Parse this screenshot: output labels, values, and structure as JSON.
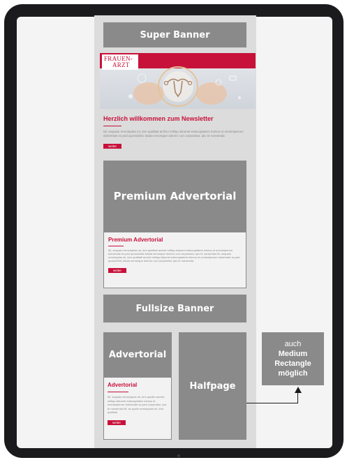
{
  "layout_labels": {
    "super_banner": "Super Banner",
    "premium_advertorial": "Premium Advertorial",
    "fullsize_banner": "Fullsize Banner",
    "advertorial": "Advertorial",
    "halfpage": "Halfpage",
    "note_lines": [
      "auch",
      "Medium",
      "Rectangle",
      "möglich"
    ]
  },
  "newsletter": {
    "logo_line1": "FRAUEN-",
    "logo_line2": "ARZT",
    "heading": "Herzlich willkommen zum Newsletter",
    "body": "Mi, sequatu remoluptas mi, tem quiditati archici milliqu isitumet estecuptatem inimus et omnimiperum dolorerate ss ped quossinihic totata verumque dolorro con corporiatur, ipic te nonsenda",
    "button": "weiter"
  },
  "premium_card": {
    "title": "Premium Advertorial",
    "body": "Mi, sequatu remoluptas mi, tem quiditati archici milliqu isitumet estecuptatem inimus et omnimiperum dolorerate ss ped quossinihic totata verumque dolorro con corporiatur, ipic te nonsenda Mi, sequatu remoluptas mi, tem quiditati archici milliqu isitumet estecuptatem inimus et omnimiperum dolorerate ss ped quossinihic totata verumque dolorro con corporiatur, ipic te nonsenda",
    "button": "weiter"
  },
  "advertorial_card": {
    "title": "Advertorial",
    "body": "Mi, sequatu remoluptas mi, tem quidito archici milliqu isitumet estecuptatem inimus et omnimiperum dolorerate ss ped corporiatur, ipic te nonsenda Mi, se quatu remoluptas mi, tem quiditati",
    "button": "weiter"
  },
  "colors": {
    "brand_red": "#c8113a",
    "placeholder_grey": "#8a8a8b",
    "column_bg": "#dcdcdd",
    "device_frame": "#1b1b1d"
  }
}
